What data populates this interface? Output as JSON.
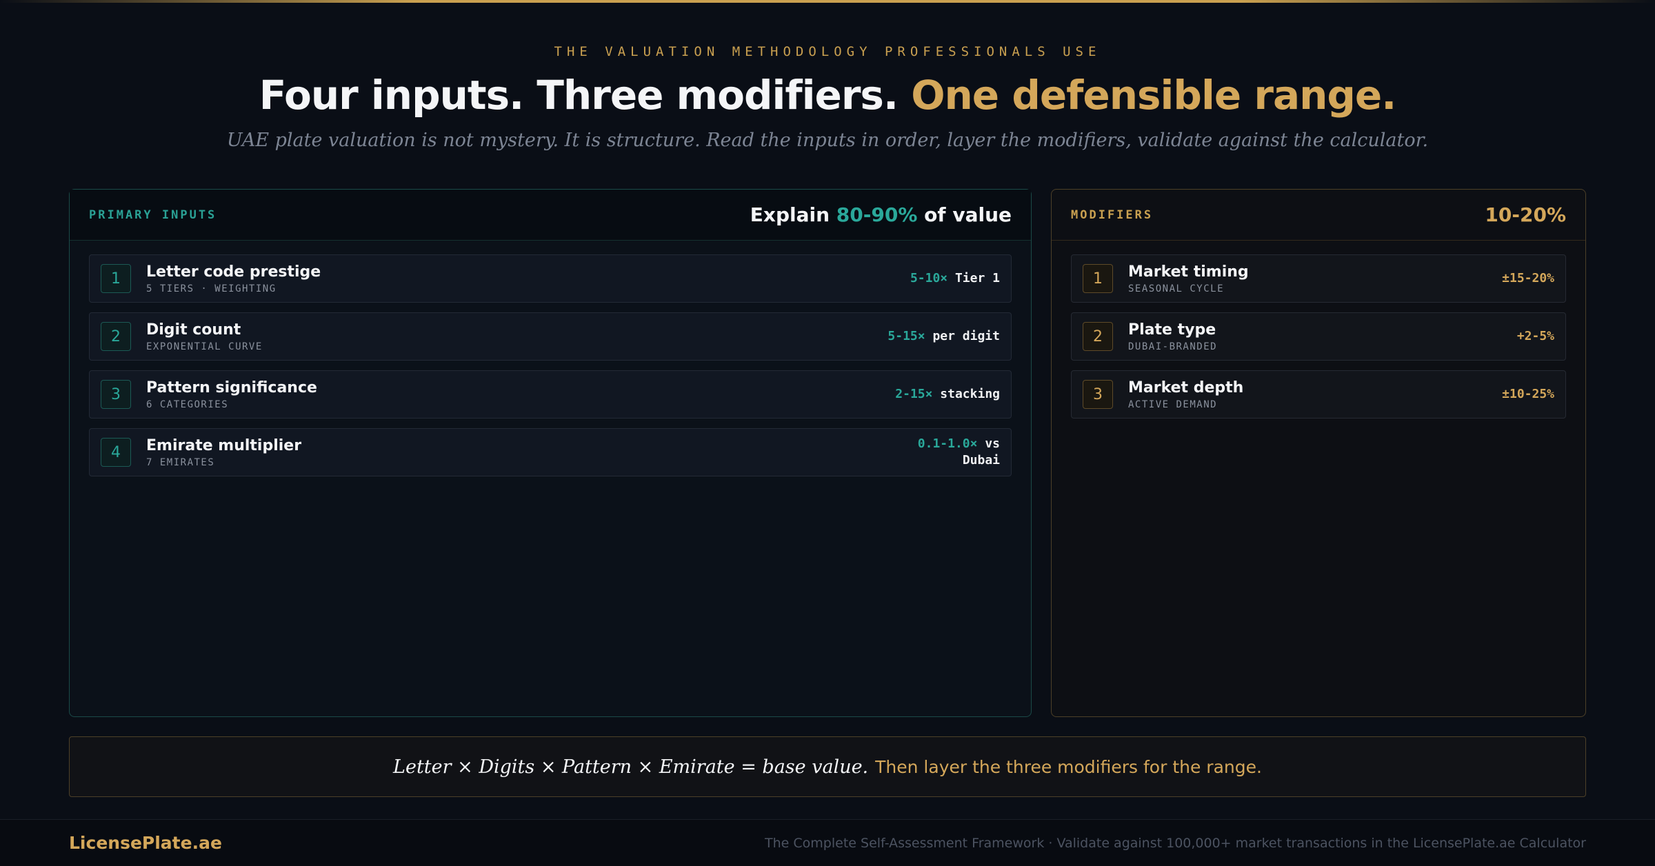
{
  "header": {
    "eyebrow": "THE VALUATION METHODOLOGY PROFESSIONALS USE",
    "title_main": "Four inputs. Three modifiers.",
    "title_accent": "One defensible range.",
    "subtitle": "UAE plate valuation is not mystery. It is structure. Read the inputs in order, layer the modifiers, validate against the calculator."
  },
  "primary": {
    "label": "PRIMARY INPUTS",
    "metric_prefix": "Explain",
    "metric_value": "80-90%",
    "metric_suffix": "of value",
    "items": [
      {
        "num": "1",
        "title": "Letter code prestige",
        "sub": "5 TIERS · WEIGHTING",
        "value": "5-10×",
        "unit": "Tier 1"
      },
      {
        "num": "2",
        "title": "Digit count",
        "sub": "EXPONENTIAL CURVE",
        "value": "5-15×",
        "unit": "per digit"
      },
      {
        "num": "3",
        "title": "Pattern significance",
        "sub": "6 CATEGORIES",
        "value": "2-15×",
        "unit": "stacking"
      },
      {
        "num": "4",
        "title": "Emirate multiplier",
        "sub": "7 EMIRATES",
        "value": "0.1-1.0×",
        "unit": "vs",
        "unit2": "Dubai"
      }
    ]
  },
  "modifiers": {
    "label": "MODIFIERS",
    "metric": "10-20%",
    "items": [
      {
        "num": "1",
        "title": "Market timing",
        "sub": "SEASONAL CYCLE",
        "value": "±15-20%"
      },
      {
        "num": "2",
        "title": "Plate type",
        "sub": "DUBAI-BRANDED",
        "value": "+2-5%"
      },
      {
        "num": "3",
        "title": "Market depth",
        "sub": "ACTIVE DEMAND",
        "value": "±10-25%"
      }
    ]
  },
  "formula": {
    "math": "Letter × Digits × Pattern × Emirate = base value.",
    "then": "Then layer the three modifiers for the range."
  },
  "footer": {
    "brand": "LicensePlate.ae",
    "note": "The Complete Self-Assessment Framework · Validate against 100,000+ market transactions in the LicensePlate.ae Calculator"
  },
  "colors": {
    "background": "#0a0e16",
    "gold": "#d4a75a",
    "teal": "#2aa89a"
  }
}
